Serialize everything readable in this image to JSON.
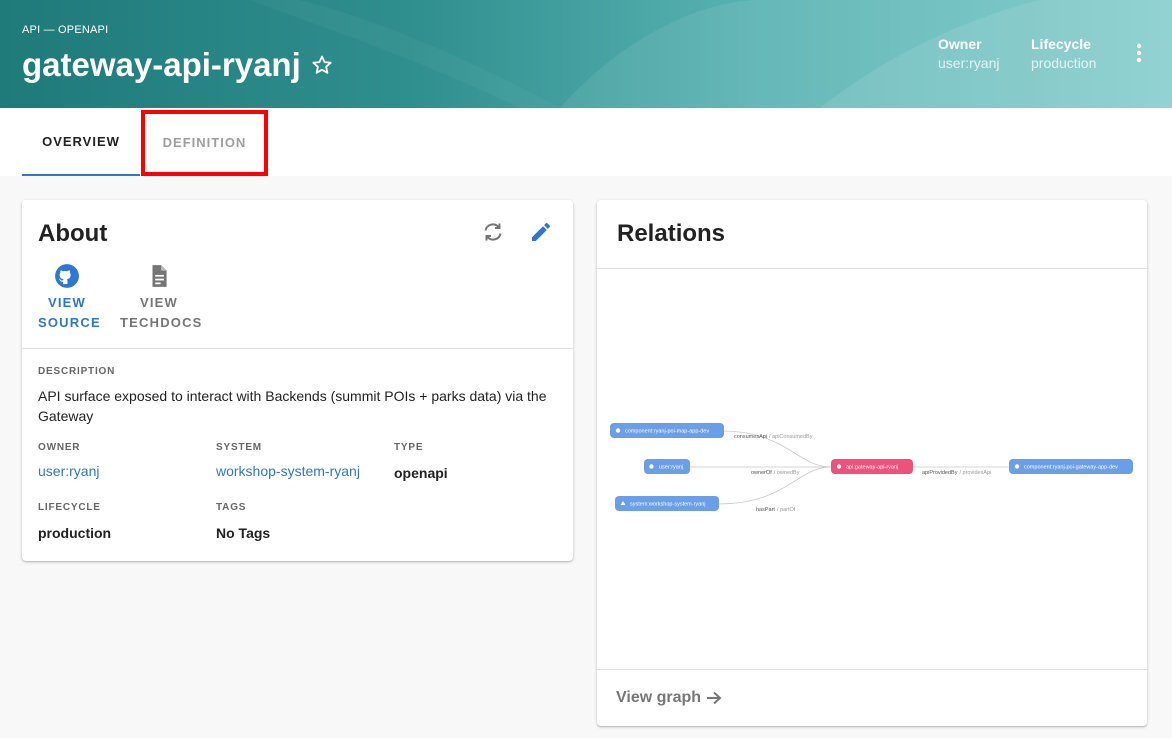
{
  "header": {
    "kind": "API — OPENAPI",
    "title": "gateway-api-ryanj",
    "owner_label": "Owner",
    "owner_value": "user:ryanj",
    "lifecycle_label": "Lifecycle",
    "lifecycle_value": "production"
  },
  "tabs": [
    {
      "label": "OVERVIEW"
    },
    {
      "label": "DEFINITION"
    }
  ],
  "about": {
    "title": "About",
    "view_source_line1": "VIEW",
    "view_source_line2": "SOURCE",
    "view_techdocs_line1": "VIEW",
    "view_techdocs_line2": "TECHDOCS",
    "description_label": "DESCRIPTION",
    "description": "API surface exposed to interact with Backends (summit POIs + parks data) via the Gateway",
    "owner_label": "OWNER",
    "owner": "user:ryanj",
    "system_label": "SYSTEM",
    "system": "workshop-system-ryanj",
    "type_label": "TYPE",
    "type": "openapi",
    "lifecycle_label": "LIFECYCLE",
    "lifecycle": "production",
    "tags_label": "TAGS",
    "tags": "No Tags"
  },
  "relations": {
    "title": "Relations",
    "view_graph": "View graph",
    "nodes": {
      "consumer": "component:ryanj-poi-map-app-dev",
      "owner": "user:ryanj",
      "system": "system:workshop-system-ryanj",
      "center": "api:gateway-api-ryanj",
      "provider": "component:ryanj-poi-gateway-app-dev"
    },
    "edges": {
      "consumes": "consumesApi",
      "consumes_inv": "/ apiConsumedBy",
      "owner": "ownerOf",
      "owner_inv": "/ ownedBy",
      "system": "hasPart",
      "system_inv": "/ partOf",
      "provides": "apiProvidedBy",
      "provides_inv": "/ providesApi"
    }
  },
  "colors": {
    "accent": "#2e77d0",
    "node": "#6a9ee6",
    "center_node": "#f0507a",
    "highlight": "#ff0000"
  }
}
